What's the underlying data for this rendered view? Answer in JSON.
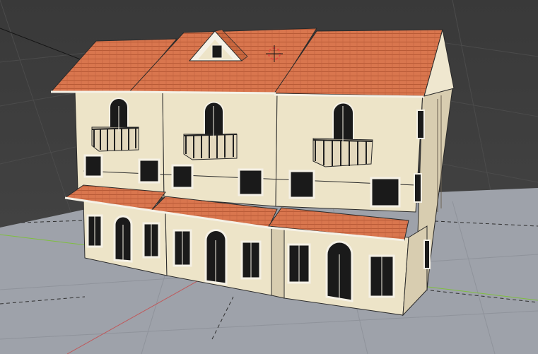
{
  "viewport": {
    "view": "3D Viewport",
    "shading": "solid",
    "colors": {
      "background_top": "#3a3a3a",
      "background_bottom": "#454545",
      "ground_plane": "#9ea2aa",
      "grid_line": "#4a4a4a",
      "axis_x": "#c0585a",
      "axis_y": "#7fbf3f",
      "wall": "#ede4c8",
      "wall_shadow": "#d8cdb0",
      "roof_tile": "#d9764e",
      "roof_tile_dark": "#b85a36",
      "window": "#1a1a1a",
      "window_frame": "#f5f1e6",
      "railing": "#202020",
      "outline": "#2a2a2a"
    }
  },
  "scene_objects": {
    "main_object": "mediterranean-villa-model",
    "cursor_3d": "3d-cursor",
    "light_line": "light-direction-line"
  }
}
